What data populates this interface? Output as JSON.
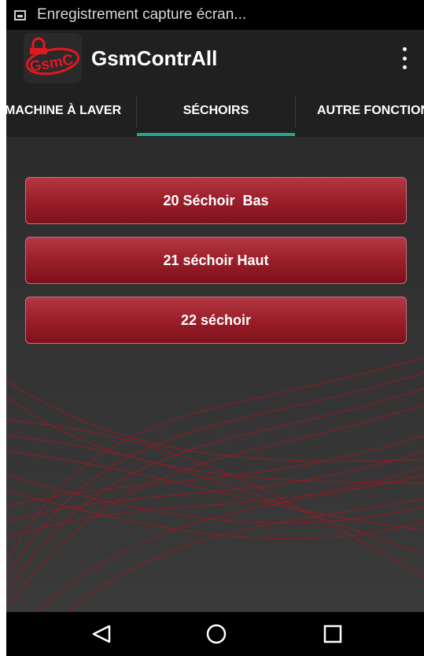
{
  "status_bar": {
    "notification_icon": "image-icon",
    "text": "Enregistrement capture écran..."
  },
  "app_bar": {
    "logo_icon": "gsmc-lock-logo",
    "logo_text": "GsmC",
    "title": "GsmContrAll",
    "menu_icon": "more-vert-icon"
  },
  "tabs": [
    {
      "label": "MACHINE À LAVER",
      "selected": false
    },
    {
      "label": "SÉCHOIRS",
      "selected": true
    },
    {
      "label": "AUTRE FONCTIONS",
      "selected": false
    }
  ],
  "colors": {
    "accent": "#27a58a",
    "button": "#9b1f2a",
    "background": "#333333"
  },
  "buttons": [
    {
      "label": "20 Séchoir  Bas"
    },
    {
      "label": "21 séchoir Haut"
    },
    {
      "label": "22 séchoir"
    }
  ],
  "nav_bar": {
    "back_icon": "triangle-back-icon",
    "home_icon": "circle-home-icon",
    "recent_icon": "square-recents-icon"
  }
}
